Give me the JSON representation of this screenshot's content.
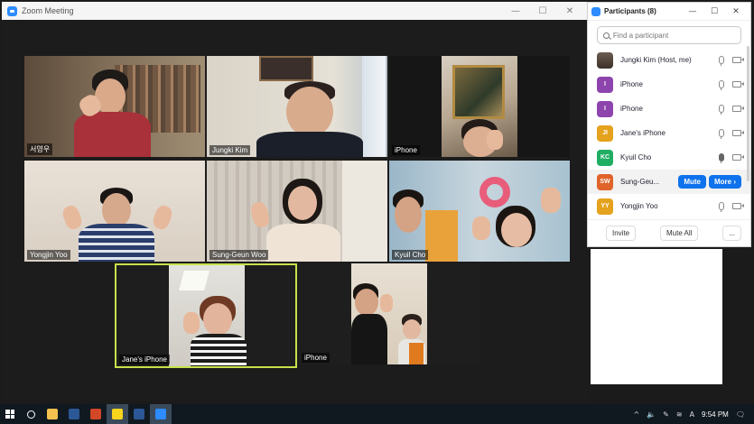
{
  "meeting_window": {
    "title": "Zoom Meeting",
    "controls": {
      "minimize": "—",
      "maximize": "☐",
      "close": "✕"
    }
  },
  "tiles": [
    {
      "name": "서영우"
    },
    {
      "name": "Jungki Kim"
    },
    {
      "name": "iPhone"
    },
    {
      "name": "Yongjin Yoo"
    },
    {
      "name": "Sung-Geun Woo"
    },
    {
      "name": "Kyuil Cho"
    },
    {
      "name": "Jane's iPhone"
    },
    {
      "name": "iPhone"
    }
  ],
  "participants_panel": {
    "title": "Participants (8)",
    "search_placeholder": "Find a participant",
    "controls": {
      "minimize": "—",
      "maximize": "☐",
      "close": "✕"
    },
    "participants": [
      {
        "name": "Jungki Kim (Host, me)",
        "avatar": "",
        "avatar_color": "photo"
      },
      {
        "name": "iPhone",
        "avatar": "I",
        "avatar_color": "#8e44ad"
      },
      {
        "name": "iPhone",
        "avatar": "I",
        "avatar_color": "#8e44ad"
      },
      {
        "name": "Jane's iPhone",
        "avatar": "JI",
        "avatar_color": "#e5a21c"
      },
      {
        "name": "Kyuil Cho",
        "avatar": "KC",
        "avatar_color": "#1fae62"
      },
      {
        "name": "Sung-Geu...",
        "avatar": "SW",
        "avatar_color": "#e0632a"
      },
      {
        "name": "Yongjin Yoo",
        "avatar": "YY",
        "avatar_color": "#e5a21c"
      }
    ],
    "row_buttons": {
      "mute": "Mute",
      "more": "More ›"
    },
    "footer": {
      "invite": "Invite",
      "mute_all": "Mute All",
      "more": "..."
    }
  },
  "taskbar": {
    "clock": "9:54 PM",
    "tray": {
      "chevron": "^",
      "volume": "🔈",
      "pen": "✎",
      "wifi": "≋",
      "ime": "A",
      "notification": "🗨"
    }
  },
  "colors": {
    "active_speaker_border": "#c6e24a",
    "zoom_blue": "#0e72ed"
  }
}
